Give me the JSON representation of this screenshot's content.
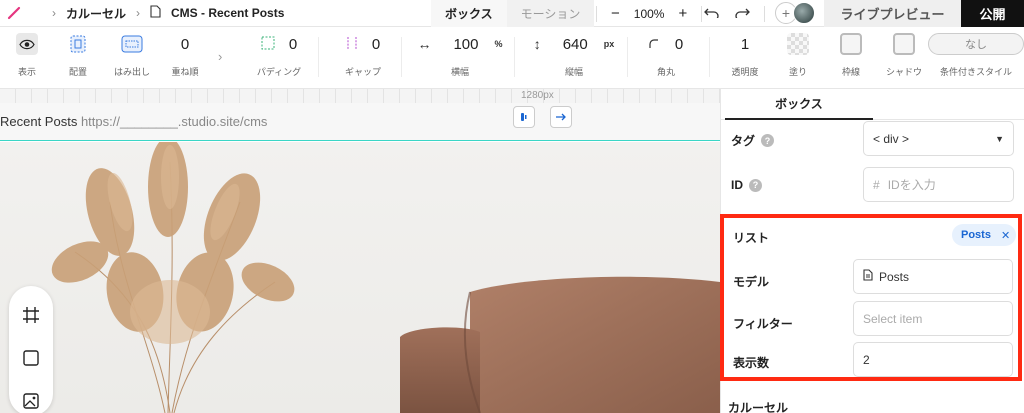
{
  "topbar": {
    "breadcrumb": [
      "カルーセル",
      "CMS - Recent Posts"
    ],
    "tabs": [
      "ボックス",
      "モーション"
    ],
    "zoom": "100%",
    "live_preview": "ライブプレビュー",
    "publish": "公開"
  },
  "toolbar": {
    "display": "表示",
    "layout": "配置",
    "overflow": "はみ出し",
    "zindex_value": "0",
    "zindex_label": "重ね順",
    "padding_value": "0",
    "padding_label": "パディング",
    "gap_value": "0",
    "gap_label": "ギャップ",
    "width_value": "100",
    "width_unit": "%",
    "width_label": "横幅",
    "height_value": "640",
    "height_unit": "px",
    "height_label": "縦幅",
    "radius_value": "0",
    "radius_label": "角丸",
    "opacity_value": "1",
    "opacity_label": "透明度",
    "fill_label": "塗り",
    "border_label": "枠線",
    "shadow_label": "シャドウ",
    "conditional_value": "なし",
    "conditional_label": "条件付きスタイル"
  },
  "canvas": {
    "width_label": "1280px",
    "page_name": "Recent Posts",
    "page_url": "https://________.studio.site/cms"
  },
  "panel": {
    "tab": "ボックス",
    "tag_label": "タグ",
    "tag_value": "< div >",
    "id_label": "ID",
    "id_placeholder": "IDを入力",
    "list_label": "リスト",
    "list_chip": "Posts",
    "model_label": "モデル",
    "model_value": "Posts",
    "filter_label": "フィルター",
    "filter_placeholder": "Select item",
    "count_label": "表示数",
    "count_value": "2",
    "carousel_label": "カルーセル"
  },
  "colors": {
    "accent_red": "#ff2a12",
    "teal": "#3bd6c6",
    "chip_blue": "#1a66d2"
  }
}
